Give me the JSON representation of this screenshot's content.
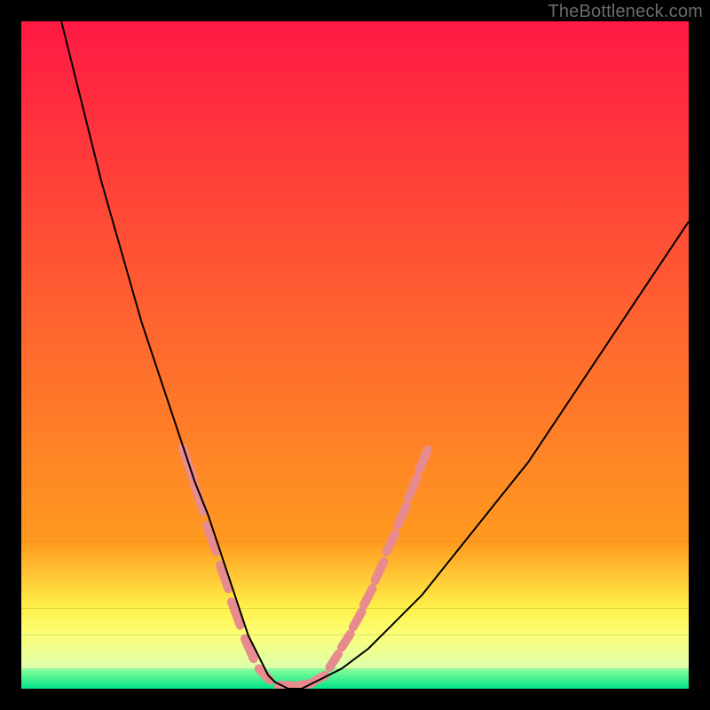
{
  "watermark": "TheBottleneck.com",
  "chart_data": {
    "type": "line",
    "title": "",
    "xlabel": "",
    "ylabel": "",
    "xlim": [
      0,
      100
    ],
    "ylim": [
      0,
      100
    ],
    "series": [
      {
        "name": "curve",
        "color": "#000000",
        "x": [
          6,
          8,
          10,
          12,
          14,
          16,
          18,
          20,
          22,
          24,
          26,
          28,
          30,
          31,
          32,
          33,
          34,
          35,
          36,
          37,
          38,
          40,
          42,
          44,
          48,
          52,
          56,
          60,
          64,
          68,
          72,
          76,
          80,
          84,
          88,
          92,
          96,
          100
        ],
        "y": [
          100,
          92,
          84,
          76,
          69,
          62,
          55,
          49,
          43,
          37,
          31,
          26,
          20,
          17,
          14,
          11,
          8,
          6,
          4,
          2,
          1,
          0,
          0,
          1,
          3,
          6,
          10,
          14,
          19,
          24,
          29,
          34,
          40,
          46,
          52,
          58,
          64,
          70
        ]
      }
    ],
    "bands": [
      {
        "name": "band-red-orange",
        "y0": 22,
        "y1": 100,
        "top": "#ff1944",
        "bottom": "#ff9a1f"
      },
      {
        "name": "band-orange-yellow",
        "y0": 12,
        "y1": 22,
        "top": "#ff9a1f",
        "bottom": "#fff24a"
      },
      {
        "name": "band-yellow-plateau",
        "y0": 8,
        "y1": 12,
        "top": "#fff24a",
        "bottom": "#fbff78"
      },
      {
        "name": "band-pale-yellow",
        "y0": 3,
        "y1": 8,
        "top": "#fbff78",
        "bottom": "#dcffad"
      },
      {
        "name": "band-green",
        "y0": 0,
        "y1": 3,
        "top": "#8aff9a",
        "bottom": "#00e58a"
      }
    ],
    "markers": {
      "name": "highlight-dashes",
      "color": "#e88b8f",
      "width": 10,
      "segments": [
        {
          "x0": 24.2,
          "y0": 36.0,
          "x1": 25.7,
          "y1": 31.5
        },
        {
          "x0": 25.9,
          "y0": 30.5,
          "x1": 27.3,
          "y1": 26.5
        },
        {
          "x0": 27.8,
          "y0": 24.5,
          "x1": 29.2,
          "y1": 20.5
        },
        {
          "x0": 29.8,
          "y0": 18.5,
          "x1": 31.0,
          "y1": 15.0
        },
        {
          "x0": 31.5,
          "y0": 13.0,
          "x1": 32.8,
          "y1": 9.5
        },
        {
          "x0": 33.5,
          "y0": 7.5,
          "x1": 34.8,
          "y1": 4.5
        },
        {
          "x0": 35.6,
          "y0": 3.0,
          "x1": 37.2,
          "y1": 1.3
        },
        {
          "x0": 38.5,
          "y0": 0.5,
          "x1": 40.5,
          "y1": 0.5
        },
        {
          "x0": 41.5,
          "y0": 0.5,
          "x1": 43.5,
          "y1": 0.8
        },
        {
          "x0": 44.0,
          "y0": 1.2,
          "x1": 45.5,
          "y1": 2.0
        },
        {
          "x0": 46.2,
          "y0": 3.2,
          "x1": 47.5,
          "y1": 5.2
        },
        {
          "x0": 48.0,
          "y0": 6.2,
          "x1": 49.3,
          "y1": 8.2
        },
        {
          "x0": 49.7,
          "y0": 9.2,
          "x1": 51.0,
          "y1": 11.5
        },
        {
          "x0": 51.3,
          "y0": 12.5,
          "x1": 52.6,
          "y1": 15.0
        },
        {
          "x0": 53.0,
          "y0": 16.2,
          "x1": 54.3,
          "y1": 19.0
        },
        {
          "x0": 54.7,
          "y0": 20.5,
          "x1": 56.0,
          "y1": 23.2
        },
        {
          "x0": 56.4,
          "y0": 24.5,
          "x1": 57.7,
          "y1": 27.4
        },
        {
          "x0": 58.0,
          "y0": 28.6,
          "x1": 59.3,
          "y1": 31.6
        },
        {
          "x0": 59.6,
          "y0": 32.8,
          "x1": 60.9,
          "y1": 35.8
        }
      ]
    }
  }
}
